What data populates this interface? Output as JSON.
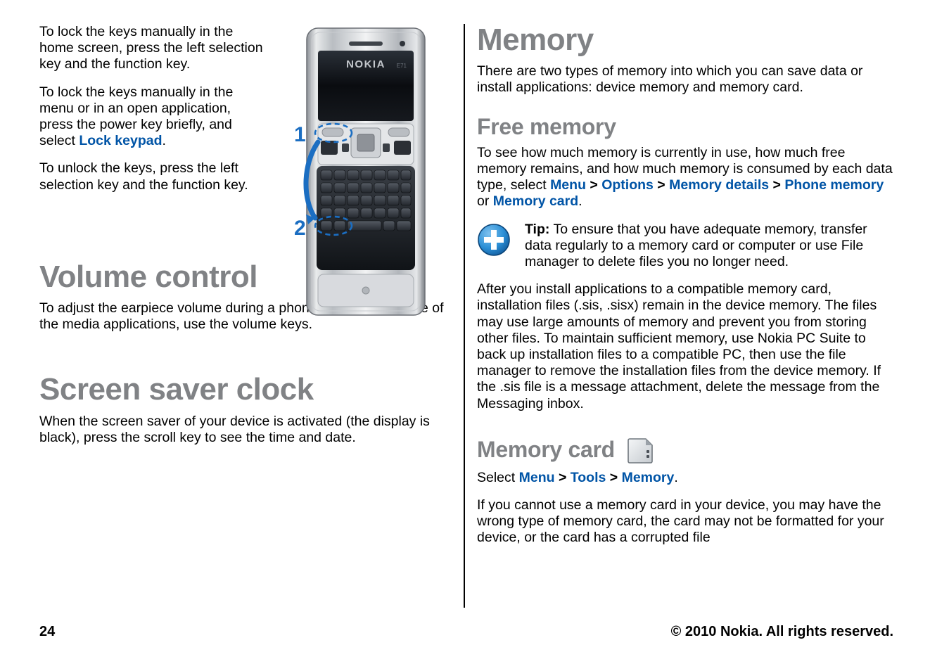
{
  "left": {
    "para1": "To lock the keys manually in the home screen, press the left selection key and the function key.",
    "para2_before": "To lock the keys manually in the menu or in an open application, press the power key briefly, and select ",
    "para2_link": "Lock keypad",
    "para2_after": ".",
    "para3": "To unlock the keys, press the left selection key and the function key.",
    "volume_heading": "Volume control",
    "volume_body": "To adjust the earpiece volume during a phone call or the volume of the media applications, use the volume keys.",
    "screensaver_heading": "Screen saver clock",
    "screensaver_body": "When the screen saver of your device is activated (the display is black), press the scroll key to see the time and date."
  },
  "figure": {
    "callout1": "1",
    "callout2": "2",
    "brand": "NOKIA"
  },
  "right": {
    "memory_heading": "Memory",
    "memory_body": "There are two types of memory into which you can save data or install applications: device memory and memory card.",
    "free_heading": "Free memory",
    "free_body_before": "To see how much memory is currently in use, how much free memory remains, and how much memory is consumed by each data type, select ",
    "free_link1": "Menu",
    "free_link2": "Options",
    "free_link3": "Memory details",
    "free_link4": "Phone memory",
    "free_or": " or ",
    "free_link5": "Memory card",
    "free_body_after": ".",
    "tip_label": "Tip:",
    "tip_text": " To ensure that you have adequate memory, transfer data regularly to a memory card or computer or use File manager to delete files you no longer need.",
    "after_install_body": "After you install applications to a compatible memory card, installation files (.sis, .sisx) remain in the device memory. The files may use large amounts of memory and prevent you from storing other files. To maintain sufficient memory, use Nokia PC Suite to back up installation files to a compatible PC, then use the file manager to remove the installation files from the device memory. If the .sis file is a message attachment, delete the message from the Messaging inbox.",
    "memcard_heading": "Memory card",
    "memcard_select_before": "Select ",
    "memcard_link1": "Menu",
    "memcard_link2": "Tools",
    "memcard_link3": "Memory",
    "memcard_select_after": ".",
    "memcard_body": "If you cannot use a memory card in your device, you may have the wrong type of memory card, the card may not be formatted for your device, or the card has a corrupted file"
  },
  "separator": ">",
  "footer": {
    "page_number": "24",
    "copyright": "© 2010 Nokia. All rights reserved."
  },
  "colors": {
    "heading_gray": "#808285",
    "link_blue": "#0054a6",
    "callout_blue": "#1b6ec2"
  }
}
